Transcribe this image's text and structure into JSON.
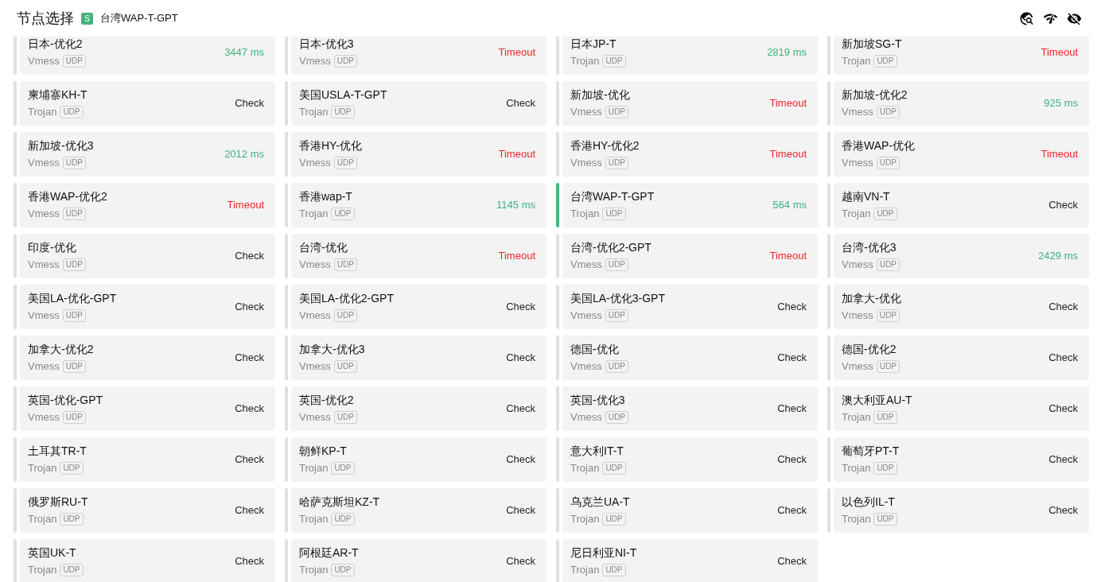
{
  "header": {
    "title": "节点选择",
    "badge": "S",
    "current": "台湾WAP-T-GPT"
  },
  "proxies": [
    {
      "name": "日本-优化2",
      "type": "Vmess",
      "udp": "UDP",
      "kind": "delay",
      "latency": "3447 ms",
      "selected": false
    },
    {
      "name": "日本-优化3",
      "type": "Vmess",
      "udp": "UDP",
      "kind": "timeout",
      "latency": "Timeout",
      "selected": false
    },
    {
      "name": "日本JP-T",
      "type": "Trojan",
      "udp": "UDP",
      "kind": "delay",
      "latency": "2819 ms",
      "selected": false
    },
    {
      "name": "新加坡SG-T",
      "type": "Trojan",
      "udp": "UDP",
      "kind": "timeout",
      "latency": "Timeout",
      "selected": false
    },
    {
      "name": "柬埔寨KH-T",
      "type": "Trojan",
      "udp": "UDP",
      "kind": "untested",
      "latency": "Check",
      "selected": false
    },
    {
      "name": "美国USLA-T-GPT",
      "type": "Trojan",
      "udp": "UDP",
      "kind": "untested",
      "latency": "Check",
      "selected": false
    },
    {
      "name": "新加坡-优化",
      "type": "Vmess",
      "udp": "UDP",
      "kind": "timeout",
      "latency": "Timeout",
      "selected": false
    },
    {
      "name": "新加坡-优化2",
      "type": "Vmess",
      "udp": "UDP",
      "kind": "delay",
      "latency": "925 ms",
      "selected": false
    },
    {
      "name": "新加坡-优化3",
      "type": "Vmess",
      "udp": "UDP",
      "kind": "delay",
      "latency": "2012 ms",
      "selected": false
    },
    {
      "name": "香港HY-优化",
      "type": "Vmess",
      "udp": "UDP",
      "kind": "timeout",
      "latency": "Timeout",
      "selected": false
    },
    {
      "name": "香港HY-优化2",
      "type": "Vmess",
      "udp": "UDP",
      "kind": "timeout",
      "latency": "Timeout",
      "selected": false
    },
    {
      "name": "香港WAP-优化",
      "type": "Vmess",
      "udp": "UDP",
      "kind": "timeout",
      "latency": "Timeout",
      "selected": false
    },
    {
      "name": "香港WAP-优化2",
      "type": "Vmess",
      "udp": "UDP",
      "kind": "timeout",
      "latency": "Timeout",
      "selected": false
    },
    {
      "name": "香港wap-T",
      "type": "Trojan",
      "udp": "UDP",
      "kind": "delay",
      "latency": "1145 ms",
      "selected": false
    },
    {
      "name": "台湾WAP-T-GPT",
      "type": "Trojan",
      "udp": "UDP",
      "kind": "delay",
      "latency": "564 ms",
      "selected": true
    },
    {
      "name": "越南VN-T",
      "type": "Trojan",
      "udp": "UDP",
      "kind": "untested",
      "latency": "Check",
      "selected": false
    },
    {
      "name": "印度-优化",
      "type": "Vmess",
      "udp": "UDP",
      "kind": "untested",
      "latency": "Check",
      "selected": false
    },
    {
      "name": "台湾-优化",
      "type": "Vmess",
      "udp": "UDP",
      "kind": "timeout",
      "latency": "Timeout",
      "selected": false
    },
    {
      "name": "台湾-优化2-GPT",
      "type": "Vmess",
      "udp": "UDP",
      "kind": "timeout",
      "latency": "Timeout",
      "selected": false
    },
    {
      "name": "台湾-优化3",
      "type": "Vmess",
      "udp": "UDP",
      "kind": "delay",
      "latency": "2429 ms",
      "selected": false
    },
    {
      "name": "美国LA-优化-GPT",
      "type": "Vmess",
      "udp": "UDP",
      "kind": "untested",
      "latency": "Check",
      "selected": false
    },
    {
      "name": "美国LA-优化2-GPT",
      "type": "Vmess",
      "udp": "UDP",
      "kind": "untested",
      "latency": "Check",
      "selected": false
    },
    {
      "name": "美国LA-优化3-GPT",
      "type": "Vmess",
      "udp": "UDP",
      "kind": "untested",
      "latency": "Check",
      "selected": false
    },
    {
      "name": "加拿大-优化",
      "type": "Vmess",
      "udp": "UDP",
      "kind": "untested",
      "latency": "Check",
      "selected": false
    },
    {
      "name": "加拿大-优化2",
      "type": "Vmess",
      "udp": "UDP",
      "kind": "untested",
      "latency": "Check",
      "selected": false
    },
    {
      "name": "加拿大-优化3",
      "type": "Vmess",
      "udp": "UDP",
      "kind": "untested",
      "latency": "Check",
      "selected": false
    },
    {
      "name": "德国-优化",
      "type": "Vmess",
      "udp": "UDP",
      "kind": "untested",
      "latency": "Check",
      "selected": false
    },
    {
      "name": "德国-优化2",
      "type": "Vmess",
      "udp": "UDP",
      "kind": "untested",
      "latency": "Check",
      "selected": false
    },
    {
      "name": "英国-优化-GPT",
      "type": "Vmess",
      "udp": "UDP",
      "kind": "untested",
      "latency": "Check",
      "selected": false
    },
    {
      "name": "英国-优化2",
      "type": "Vmess",
      "udp": "UDP",
      "kind": "untested",
      "latency": "Check",
      "selected": false
    },
    {
      "name": "英国-优化3",
      "type": "Vmess",
      "udp": "UDP",
      "kind": "untested",
      "latency": "Check",
      "selected": false
    },
    {
      "name": "澳大利亚AU-T",
      "type": "Trojan",
      "udp": "UDP",
      "kind": "untested",
      "latency": "Check",
      "selected": false
    },
    {
      "name": "土耳其TR-T",
      "type": "Trojan",
      "udp": "UDP",
      "kind": "untested",
      "latency": "Check",
      "selected": false
    },
    {
      "name": "朝鲜KP-T",
      "type": "Trojan",
      "udp": "UDP",
      "kind": "untested",
      "latency": "Check",
      "selected": false
    },
    {
      "name": "意大利IT-T",
      "type": "Trojan",
      "udp": "UDP",
      "kind": "untested",
      "latency": "Check",
      "selected": false
    },
    {
      "name": "葡萄牙PT-T",
      "type": "Trojan",
      "udp": "UDP",
      "kind": "untested",
      "latency": "Check",
      "selected": false
    },
    {
      "name": "俄罗斯RU-T",
      "type": "Trojan",
      "udp": "UDP",
      "kind": "untested",
      "latency": "Check",
      "selected": false
    },
    {
      "name": "哈萨克斯坦KZ-T",
      "type": "Trojan",
      "udp": "UDP",
      "kind": "untested",
      "latency": "Check",
      "selected": false
    },
    {
      "name": "乌克兰UA-T",
      "type": "Trojan",
      "udp": "UDP",
      "kind": "untested",
      "latency": "Check",
      "selected": false
    },
    {
      "name": "以色列IL-T",
      "type": "Trojan",
      "udp": "UDP",
      "kind": "untested",
      "latency": "Check",
      "selected": false
    },
    {
      "name": "英国UK-T",
      "type": "Trojan",
      "udp": "UDP",
      "kind": "untested",
      "latency": "Check",
      "selected": false
    },
    {
      "name": "阿根廷AR-T",
      "type": "Trojan",
      "udp": "UDP",
      "kind": "untested",
      "latency": "Check",
      "selected": false
    },
    {
      "name": "尼日利亚NI-T",
      "type": "Trojan",
      "udp": "UDP",
      "kind": "untested",
      "latency": "Check",
      "selected": false
    }
  ]
}
